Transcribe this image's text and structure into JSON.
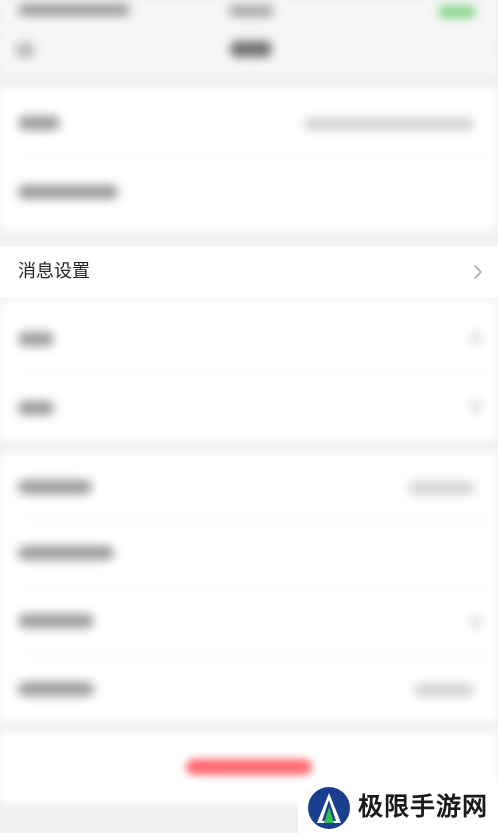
{
  "settings": {
    "message_settings_label": "消息设置"
  },
  "watermark": {
    "text": "极限手游网"
  },
  "colors": {
    "background": "#f1f1f1",
    "danger": "#ff6b74",
    "status_green": "#7dd383"
  }
}
